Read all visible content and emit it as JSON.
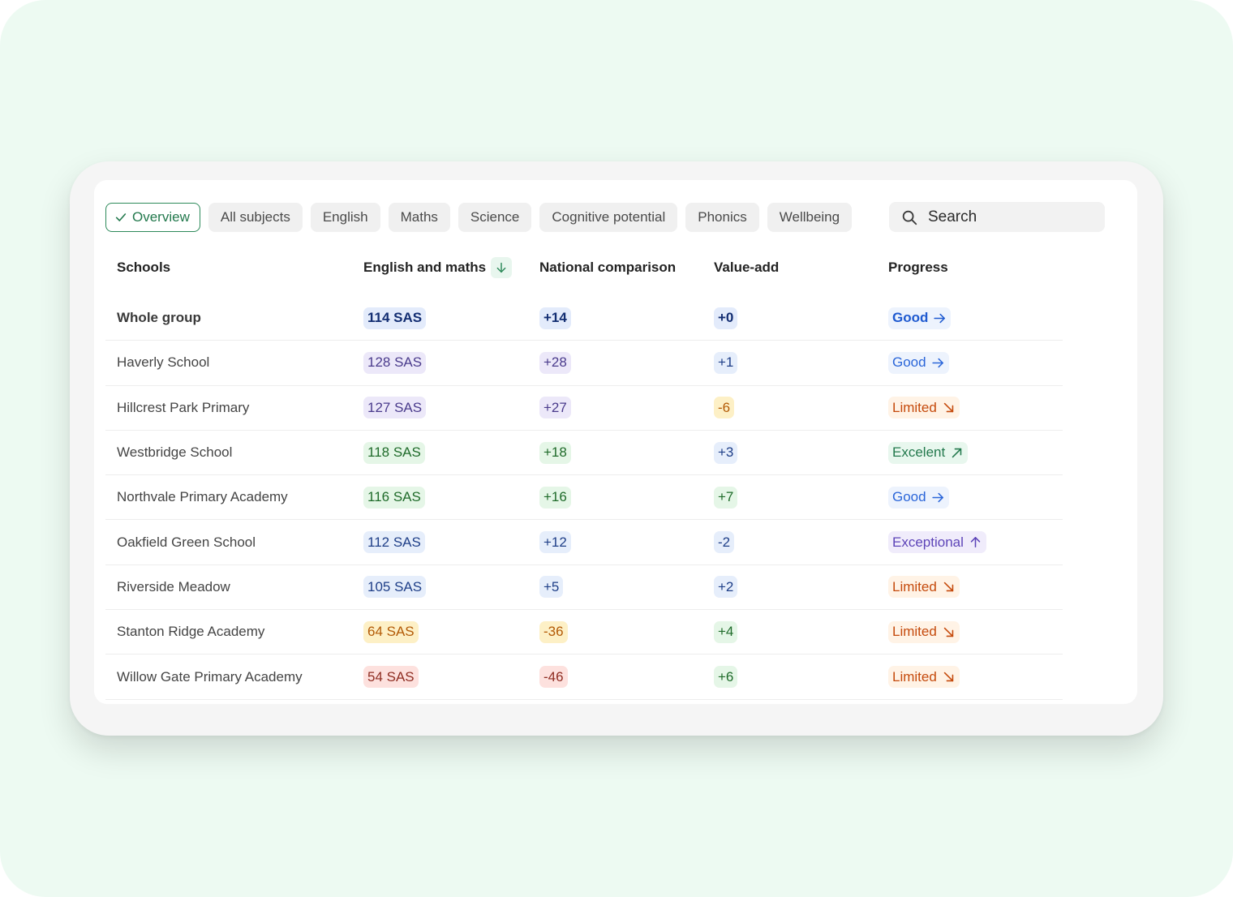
{
  "filters": {
    "chips": [
      {
        "label": "Overview",
        "active": true
      },
      {
        "label": "All subjects",
        "active": false
      },
      {
        "label": "English",
        "active": false
      },
      {
        "label": "Maths",
        "active": false
      },
      {
        "label": "Science",
        "active": false
      },
      {
        "label": "Cognitive potential",
        "active": false
      },
      {
        "label": "Phonics",
        "active": false
      },
      {
        "label": "Wellbeing",
        "active": false
      }
    ],
    "search_placeholder": "Search"
  },
  "table": {
    "headers": {
      "schools": "Schools",
      "score": "English and maths",
      "national": "National comparison",
      "value_add": "Value-add",
      "progress": "Progress"
    },
    "rows": [
      {
        "school": "Whole group",
        "score": "114 SAS",
        "score_tone": "navy",
        "national": "+14",
        "national_tone": "navy",
        "value_add": "+0",
        "value_tone": "navy",
        "progress": "Good",
        "progress_tone": "good-strong",
        "trend": "right"
      },
      {
        "school": "Haverly School",
        "score": "128 SAS",
        "score_tone": "purple",
        "national": "+28",
        "national_tone": "purple",
        "value_add": "+1",
        "value_tone": "blue",
        "progress": "Good",
        "progress_tone": "good",
        "trend": "right"
      },
      {
        "school": "Hillcrest Park Primary",
        "score": "127 SAS",
        "score_tone": "purple",
        "national": "+27",
        "national_tone": "purple",
        "value_add": "-6",
        "value_tone": "yellow",
        "progress": "Limited",
        "progress_tone": "limited",
        "trend": "down-right"
      },
      {
        "school": "Westbridge School",
        "score": "118 SAS",
        "score_tone": "green",
        "national": "+18",
        "national_tone": "green",
        "value_add": "+3",
        "value_tone": "blue",
        "progress": "Excelent",
        "progress_tone": "excel",
        "trend": "up-right"
      },
      {
        "school": "Northvale Primary Academy",
        "score": "116 SAS",
        "score_tone": "green",
        "national": "+16",
        "national_tone": "green",
        "value_add": "+7",
        "value_tone": "green",
        "progress": "Good",
        "progress_tone": "good",
        "trend": "right"
      },
      {
        "school": "Oakfield Green School",
        "score": "112 SAS",
        "score_tone": "blue",
        "national": "+12",
        "national_tone": "blue",
        "value_add": "-2",
        "value_tone": "blue",
        "progress": "Exceptional",
        "progress_tone": "except",
        "trend": "up"
      },
      {
        "school": "Riverside Meadow",
        "score": "105 SAS",
        "score_tone": "blue",
        "national": "+5",
        "national_tone": "blue",
        "value_add": "+2",
        "value_tone": "blue",
        "progress": "Limited",
        "progress_tone": "limited",
        "trend": "down-right"
      },
      {
        "school": "Stanton Ridge Academy",
        "score": "64 SAS",
        "score_tone": "yellow",
        "national": "-36",
        "national_tone": "yellow",
        "value_add": "+4",
        "value_tone": "green",
        "progress": "Limited",
        "progress_tone": "limited",
        "trend": "down-right"
      },
      {
        "school": "Willow Gate Primary Academy",
        "score": "54 SAS",
        "score_tone": "red",
        "national": "-46",
        "national_tone": "red",
        "value_add": "+6",
        "value_tone": "green",
        "progress": "Limited",
        "progress_tone": "limited",
        "trend": "down-right"
      }
    ]
  },
  "colors": {
    "accent_green": "#2d8a5a",
    "page_background": "#edfaf2"
  },
  "icons": {
    "check": "check-icon",
    "search": "search-icon",
    "sort": "arrow-down-icon"
  }
}
